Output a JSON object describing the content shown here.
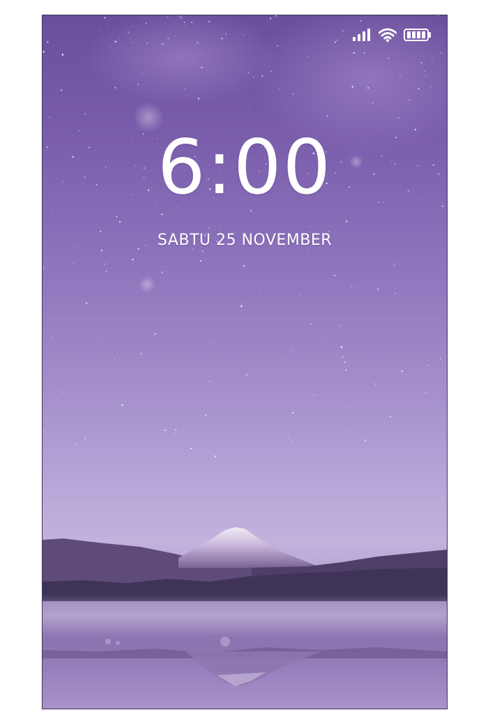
{
  "lockscreen": {
    "time": "6:00",
    "date": "SABTU 25 NOVEMBER"
  },
  "status_bar": {
    "icons": [
      "cellular-signal-icon",
      "wifi-icon",
      "battery-icon"
    ],
    "battery_level": 1.0
  },
  "colors": {
    "sky_top": "#6a4f9c",
    "sky_mid": "#9077be",
    "sky_horizon": "#c2b2dd",
    "text": "#ffffff"
  }
}
